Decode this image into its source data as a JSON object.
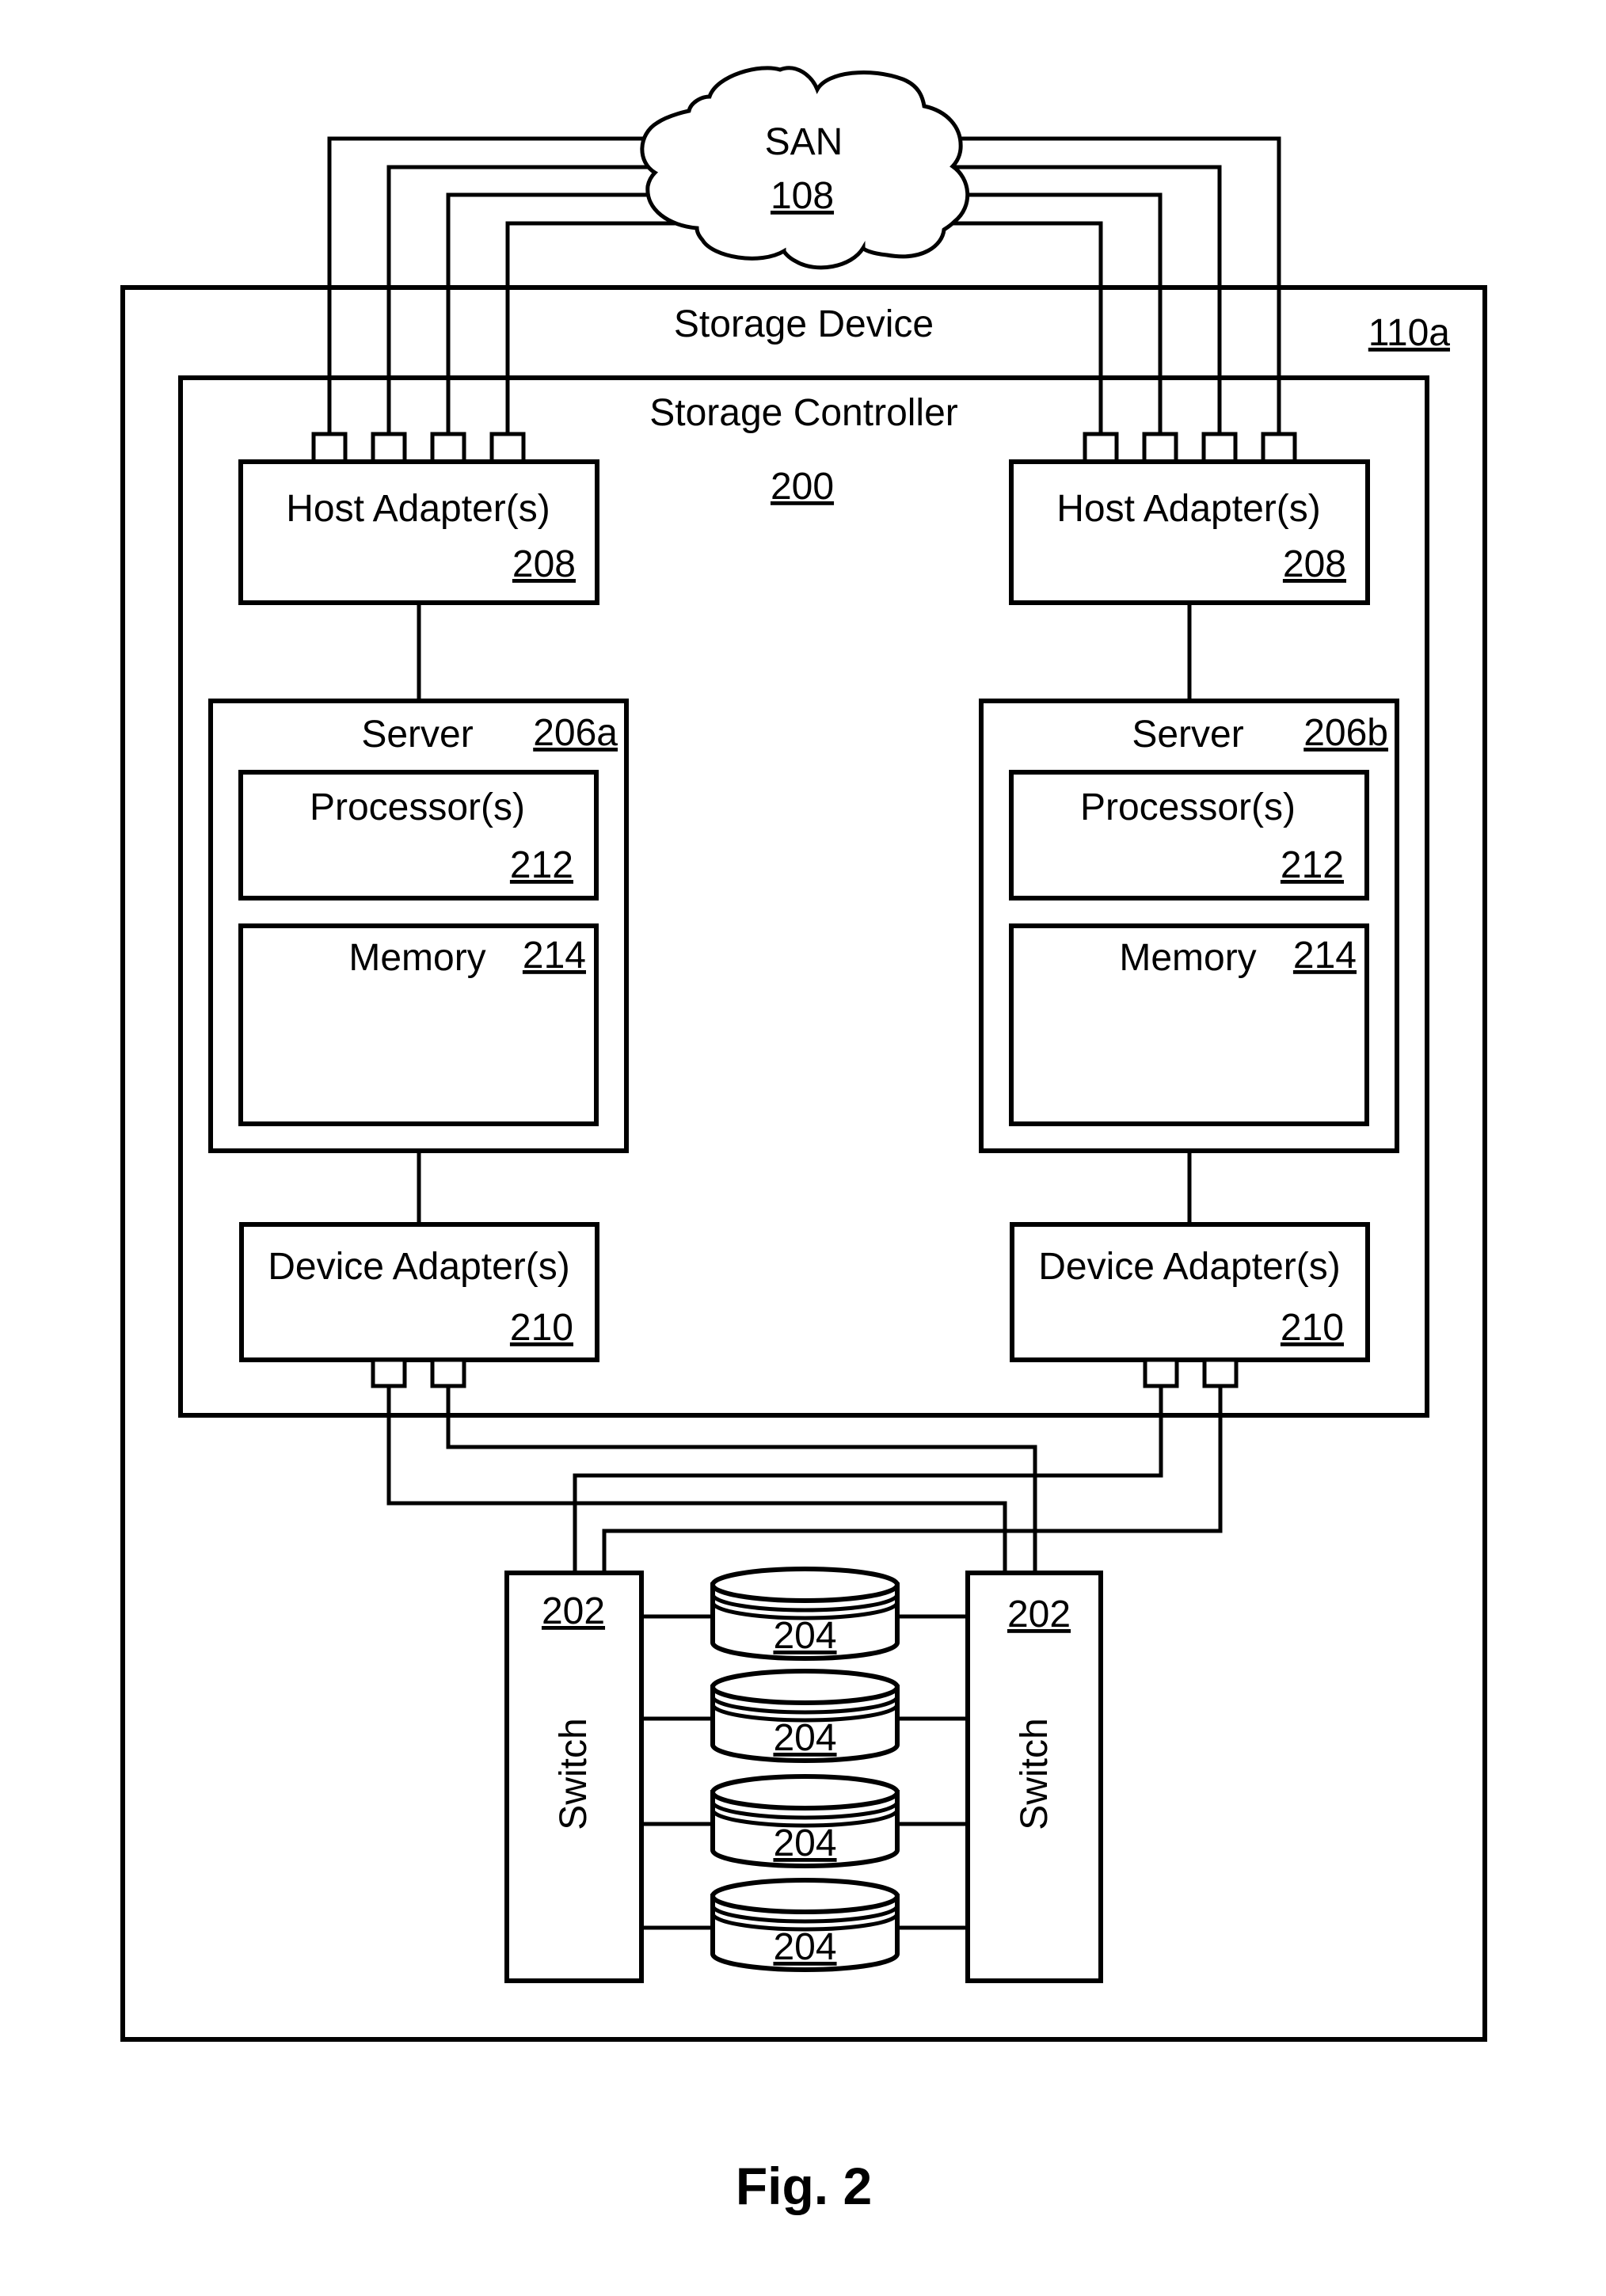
{
  "figure": {
    "caption": "Fig. 2",
    "san": {
      "label": "SAN",
      "ref": "108"
    },
    "storage_device": {
      "label": "Storage Device",
      "ref": "110a"
    },
    "storage_controller": {
      "label": "Storage Controller",
      "ref": "200"
    },
    "host_adapters": [
      {
        "label": "Host Adapter(s)",
        "ref": "208",
        "ports": 4
      },
      {
        "label": "Host Adapter(s)",
        "ref": "208",
        "ports": 4
      }
    ],
    "servers": [
      {
        "label": "Server",
        "ref": "206a",
        "processor": {
          "label": "Processor(s)",
          "ref": "212"
        },
        "memory": {
          "label": "Memory",
          "ref": "214"
        }
      },
      {
        "label": "Server",
        "ref": "206b",
        "processor": {
          "label": "Processor(s)",
          "ref": "212"
        },
        "memory": {
          "label": "Memory",
          "ref": "214"
        }
      }
    ],
    "device_adapters": [
      {
        "label": "Device Adapter(s)",
        "ref": "210",
        "ports": 2
      },
      {
        "label": "Device Adapter(s)",
        "ref": "210",
        "ports": 2
      }
    ],
    "switches": [
      {
        "label": "Switch",
        "ref": "202"
      },
      {
        "label": "Switch",
        "ref": "202"
      }
    ],
    "disks": [
      {
        "ref": "204"
      },
      {
        "ref": "204"
      },
      {
        "ref": "204"
      },
      {
        "ref": "204"
      }
    ]
  }
}
